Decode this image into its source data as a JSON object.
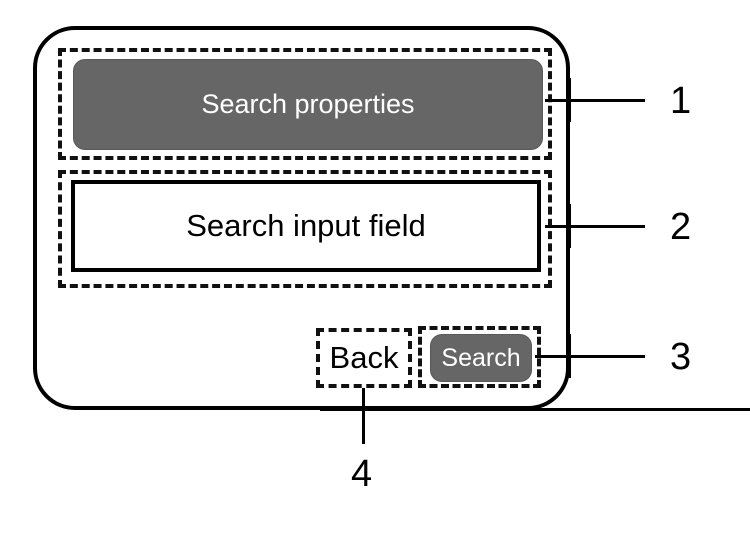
{
  "diagram": {
    "type": "annotated-ui-wireframe",
    "background_color": "#ffffff",
    "frame": {
      "name": "screen-frame",
      "stroke_color": "#000000",
      "corner_radius": "42px"
    },
    "accent_gray": "#666666",
    "annotation_stroke": "#111111"
  },
  "screen": {
    "title_button": {
      "label": "Search properties",
      "style": "filled-gray-rounded",
      "fill": "#666666",
      "text_color": "#ffffff"
    },
    "search_field": {
      "value": "Search input field",
      "placeholder": "Search input field",
      "style": "white-box-black-border",
      "text_color": "#000000"
    },
    "actions": {
      "back": {
        "label": "Back",
        "style": "plain-text",
        "text_color": "#000000"
      },
      "search": {
        "label": "Search",
        "style": "filled-gray-rounded",
        "fill": "#666666",
        "text_color": "#ffffff"
      }
    }
  },
  "callouts": [
    {
      "number": "1",
      "target": "Search properties button region"
    },
    {
      "number": "2",
      "target": "Search input field region"
    },
    {
      "number": "3",
      "target": "Search button region"
    },
    {
      "number": "4",
      "target": "Back button region"
    }
  ]
}
